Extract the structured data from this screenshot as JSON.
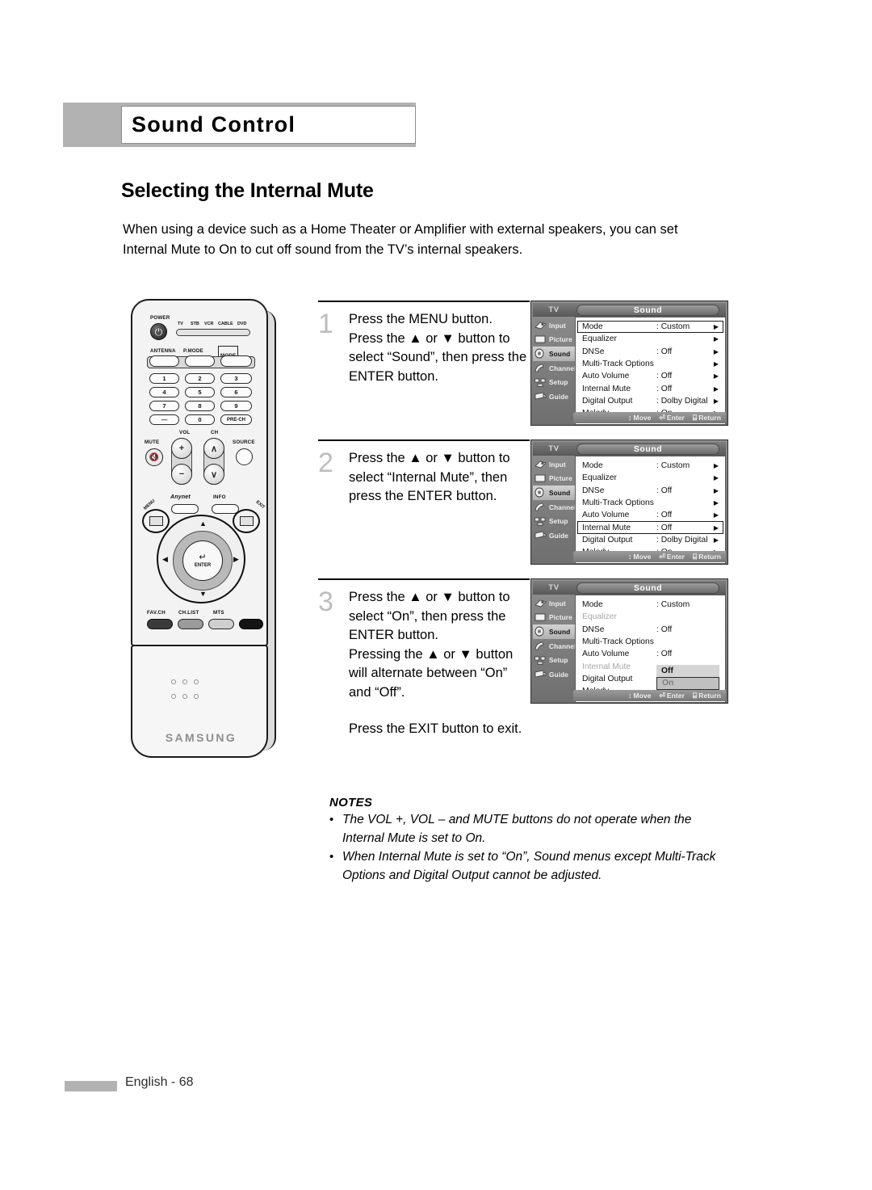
{
  "chapter": {
    "title": "Sound Control"
  },
  "section": {
    "heading": "Selecting the Internal Mute"
  },
  "intro": "When using a device such as a Home Theater or Amplifier with external speakers, you can set Internal Mute to On to cut off sound from the TV’s internal speakers.",
  "steps": [
    {
      "number": "1",
      "lines": [
        "Press the MENU button.",
        "Press the ▲ or ▼ button to select “Sound”, then press the ENTER button."
      ]
    },
    {
      "number": "2",
      "lines": [
        "Press the ▲ or ▼ button to select “Internal Mute”, then press the ENTER button."
      ]
    },
    {
      "number": "3",
      "lines": [
        "Press the ▲ or ▼ button to select “On”, then press the ENTER button.",
        "Pressing the ▲ or ▼ button will alternate between “On” and “Off”."
      ],
      "extra": "Press the EXIT button to exit."
    }
  ],
  "osd": {
    "source_label": "TV",
    "title": "Sound",
    "sidebar": [
      {
        "label": "Input",
        "icon": "input-icon"
      },
      {
        "label": "Picture",
        "icon": "picture-icon"
      },
      {
        "label": "Sound",
        "icon": "sound-icon"
      },
      {
        "label": "Channel",
        "icon": "channel-icon"
      },
      {
        "label": "Setup",
        "icon": "setup-icon"
      },
      {
        "label": "Guide",
        "icon": "guide-icon"
      }
    ],
    "active_sidebar": "Sound",
    "rows": [
      {
        "name": "Mode",
        "value": ": Custom"
      },
      {
        "name": "Equalizer",
        "value": ""
      },
      {
        "name": "DNSe",
        "value": ": Off"
      },
      {
        "name": "Multi-Track Options",
        "value": ""
      },
      {
        "name": "Auto Volume",
        "value": ": Off"
      },
      {
        "name": "Internal Mute",
        "value": ": Off"
      },
      {
        "name": "Digital Output",
        "value": ": Dolby Digital"
      },
      {
        "name": "Melody",
        "value": ": On"
      }
    ],
    "arrow_glyph": "▶",
    "footer": {
      "move_glyph": "↕",
      "move_label": "Move",
      "enter_glyph": "⏎",
      "enter_label": "Enter",
      "return_glyph": "⌸",
      "return_label": "Return"
    },
    "dropdown": {
      "off_label": "Off",
      "on_label": "On"
    },
    "panel1_selected_row": "Mode",
    "panel2_selected_row": "Internal Mute",
    "panel3_dimmed_rows": [
      "Equalizer",
      "Multi-Track Options",
      "Internal Mute"
    ]
  },
  "remote": {
    "power_label": "POWER",
    "power_glyph": "⏻",
    "device_modes": [
      "TV",
      "STB",
      "VCR",
      "CABLE",
      "DVD"
    ],
    "fn_labels": [
      "ANTENNA",
      "P.MODE",
      "MODE"
    ],
    "keypad": [
      "1",
      "2",
      "3",
      "4",
      "5",
      "6",
      "7",
      "8",
      "9",
      "—",
      "0",
      "PRE-CH"
    ],
    "vol_label": "VOL",
    "ch_label": "CH",
    "vol_up": "+",
    "vol_down": "−",
    "ch_up": "∧",
    "ch_down": "∨",
    "mute_label": "MUTE",
    "mute_glyph": "·⃠",
    "source_label": "SOURCE",
    "anynet_label": "Anynet",
    "info_label": "INFO",
    "menu_label": "MENU",
    "exit_label": "EXIT",
    "enter_label": "ENTER",
    "enter_glyph": "↵",
    "arrow_up": "▲",
    "arrow_down": "▼",
    "arrow_left": "◀",
    "arrow_right": "▶",
    "bottom_keys": [
      "FAV.CH",
      "CH.LIST",
      "MTS"
    ],
    "brand": "SAMSUNG"
  },
  "notes": {
    "title": "NOTES",
    "bullet": "•",
    "items": [
      "The VOL +, VOL – and MUTE buttons do not operate when the Internal Mute is set to On.",
      "When Internal Mute is set to “On”, Sound menus except Multi-Track Options and Digital Output cannot be adjusted."
    ]
  },
  "footer": {
    "text": "English - 68"
  }
}
